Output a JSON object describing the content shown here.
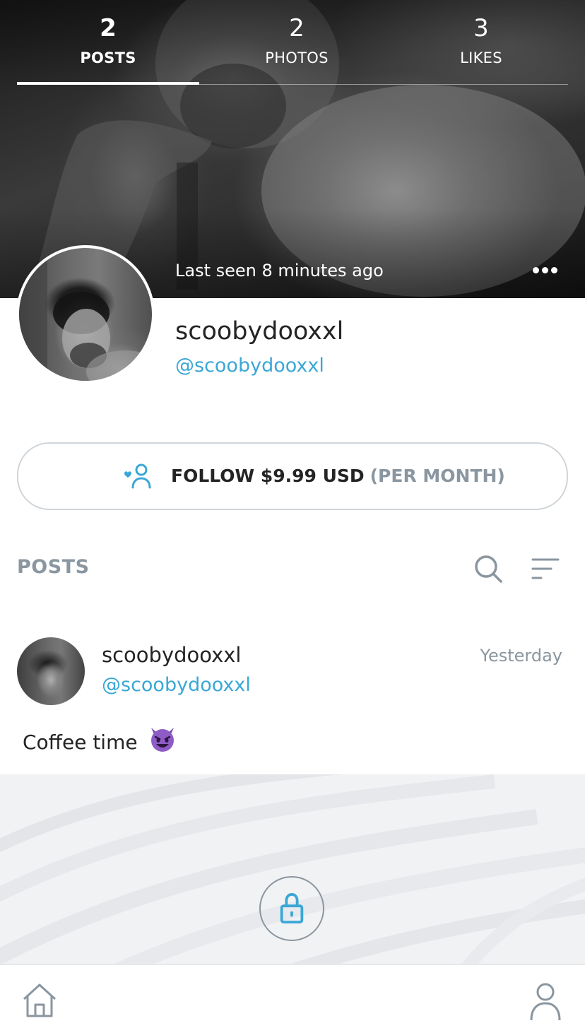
{
  "colors": {
    "accent": "#3aa7d6",
    "muted": "#8a96a0",
    "text": "#242424",
    "border": "#cfd5da"
  },
  "tabs": [
    {
      "count": "2",
      "label": "POSTS",
      "active": true
    },
    {
      "count": "2",
      "label": "PHOTOS",
      "active": false
    },
    {
      "count": "3",
      "label": "LIKES",
      "active": false
    }
  ],
  "cover": {
    "last_seen": "Last seen 8 minutes ago",
    "more_icon": "more-horizontal-icon"
  },
  "profile": {
    "name": "scoobydooxxl",
    "handle": "@scoobydooxxl"
  },
  "follow": {
    "icon": "add-user-heart-icon",
    "main_label": "FOLLOW $9.99 USD",
    "sub_label": "(PER MONTH)"
  },
  "posts_section": {
    "title": "POSTS",
    "search_icon": "search-icon",
    "sort_icon": "sort-icon"
  },
  "post": {
    "author_name": "scoobydooxxl",
    "author_handle": "@scoobydooxxl",
    "time": "Yesterday",
    "text": "Coffee time",
    "emoji": "smiling-devil-emoji",
    "media_state": "locked",
    "lock_icon": "lock-icon"
  },
  "bottom_nav": {
    "home_icon": "home-icon",
    "profile_icon": "user-icon"
  }
}
